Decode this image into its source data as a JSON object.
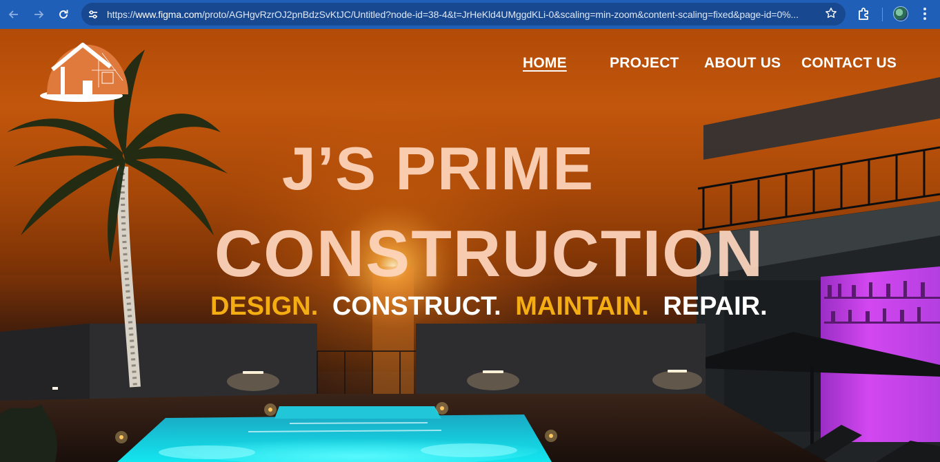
{
  "browser": {
    "url_prefix": "https://",
    "url_domain": "www.figma.com",
    "url_rest": "/proto/AGHgvRzrOJ2pnBdzSvKtJC/Untitled?node-id=38-4&t=JrHeKld4UMggdKLi-0&scaling=min-zoom&content-scaling=fixed&page-id=0%...",
    "icons": {
      "back": "arrow-left-icon",
      "forward": "arrow-right-icon",
      "reload": "reload-icon",
      "site_info": "tune-icon",
      "bookmark": "star-icon",
      "extensions": "puzzle-icon",
      "menu": "more-vert-icon"
    }
  },
  "site": {
    "logo": "house-logo",
    "nav": [
      {
        "label": "HOME",
        "active": true
      },
      {
        "label": "PROJECT",
        "active": false
      },
      {
        "label": "ABOUT US",
        "active": false
      },
      {
        "label": "CONTACT US",
        "active": false
      }
    ],
    "headline_line1": "J’S PRIME",
    "headline_line2": "CONSTRUCTION",
    "tagline": [
      {
        "text": "DESIGN.",
        "color": "#f4ad12"
      },
      {
        "text": "CONSTRUCT.",
        "color": "#ffffff"
      },
      {
        "text": "MAINTAIN.",
        "color": "#f4ad12"
      },
      {
        "text": "REPAIR.",
        "color": "#ffffff"
      }
    ]
  },
  "colors": {
    "chrome_bg": "#1f5fb8",
    "omnibox_bg": "#18488f",
    "sky_orange": "#c2560c",
    "pool_cyan": "#19d6e6",
    "bar_magenta": "#c438e6"
  }
}
